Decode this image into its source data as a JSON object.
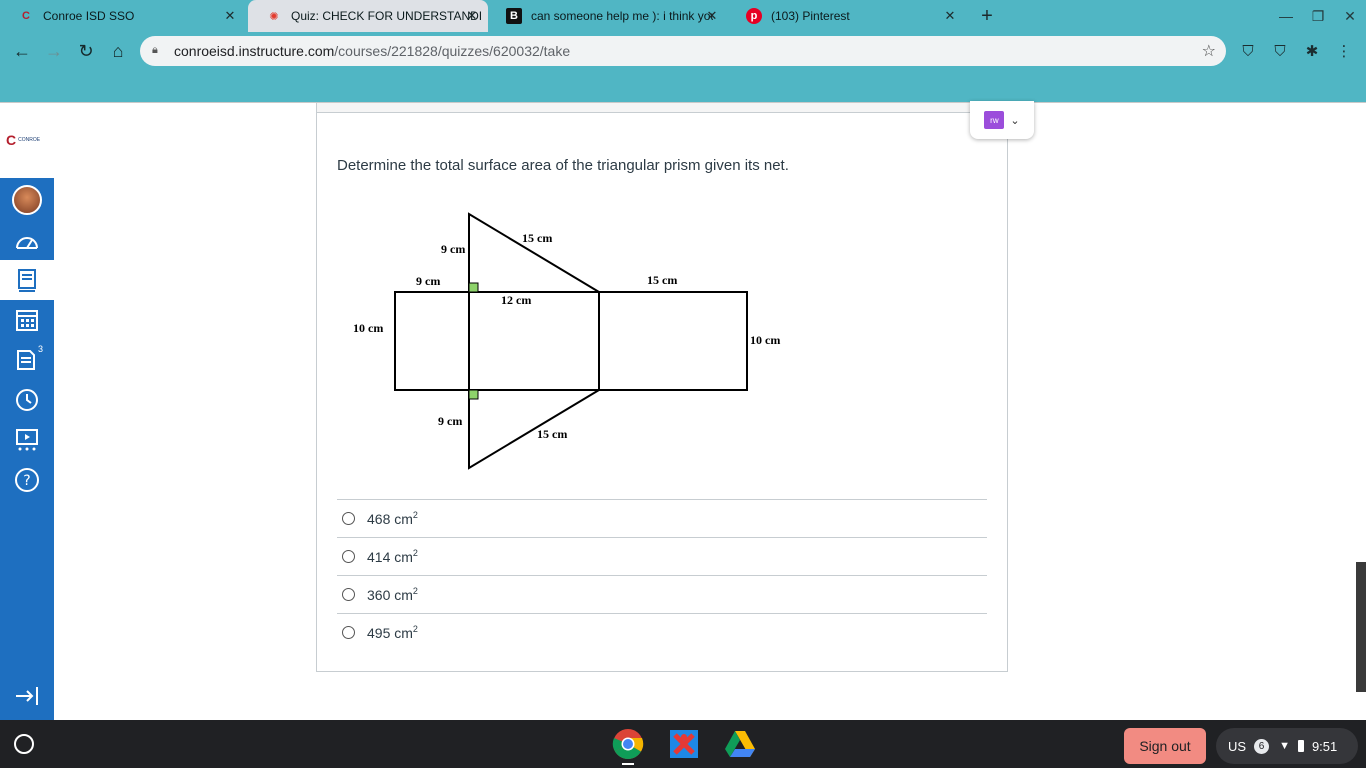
{
  "browser": {
    "tabs": [
      {
        "title": "Conroe ISD SSO",
        "active": false
      },
      {
        "title": "Quiz: CHECK FOR UNDERSTANDING",
        "active": true
      },
      {
        "title": "can someone help me ): i think you",
        "active": false
      },
      {
        "title": "(103) Pinterest",
        "active": false
      }
    ],
    "url_host": "conroeisd.instructure.com",
    "url_path": "/courses/221828/quizzes/620032/take",
    "accent_color": "#50b6c4"
  },
  "sidebar": {
    "logo_text": "CONROE",
    "inbox_badge": "3",
    "items": [
      {
        "icon": "account-avatar"
      },
      {
        "icon": "dashboard-icon"
      },
      {
        "icon": "courses-icon",
        "active": true
      },
      {
        "icon": "calendar-icon"
      },
      {
        "icon": "inbox-icon"
      },
      {
        "icon": "history-icon"
      },
      {
        "icon": "studio-icon"
      },
      {
        "icon": "help-icon"
      }
    ],
    "collapse_icon": "collapse-arrow-icon",
    "brand_color": "#1e6fc0"
  },
  "quiz": {
    "question": "Determine the total surface area of the triangular prism given its net.",
    "net_labels": {
      "top_tri_left": "9 cm",
      "top_tri_hyp": "15 cm",
      "left_rect_top": "9 cm",
      "left_rect_side": "10 cm",
      "middle_rect_top": "12 cm",
      "right_rect_top": "15 cm",
      "right_rect_side": "10 cm",
      "bottom_tri_left": "9 cm",
      "bottom_tri_hyp": "15 cm"
    },
    "answers": [
      {
        "value": "468 cm",
        "exp": "2"
      },
      {
        "value": "414 cm",
        "exp": "2"
      },
      {
        "value": "360 cm",
        "exp": "2"
      },
      {
        "value": "495 cm",
        "exp": "2"
      }
    ]
  },
  "extension_popup": {
    "label": "rw"
  },
  "shelf": {
    "signout_label": "Sign out",
    "keyboard": "US",
    "notification_count": "6",
    "time": "9:51"
  }
}
